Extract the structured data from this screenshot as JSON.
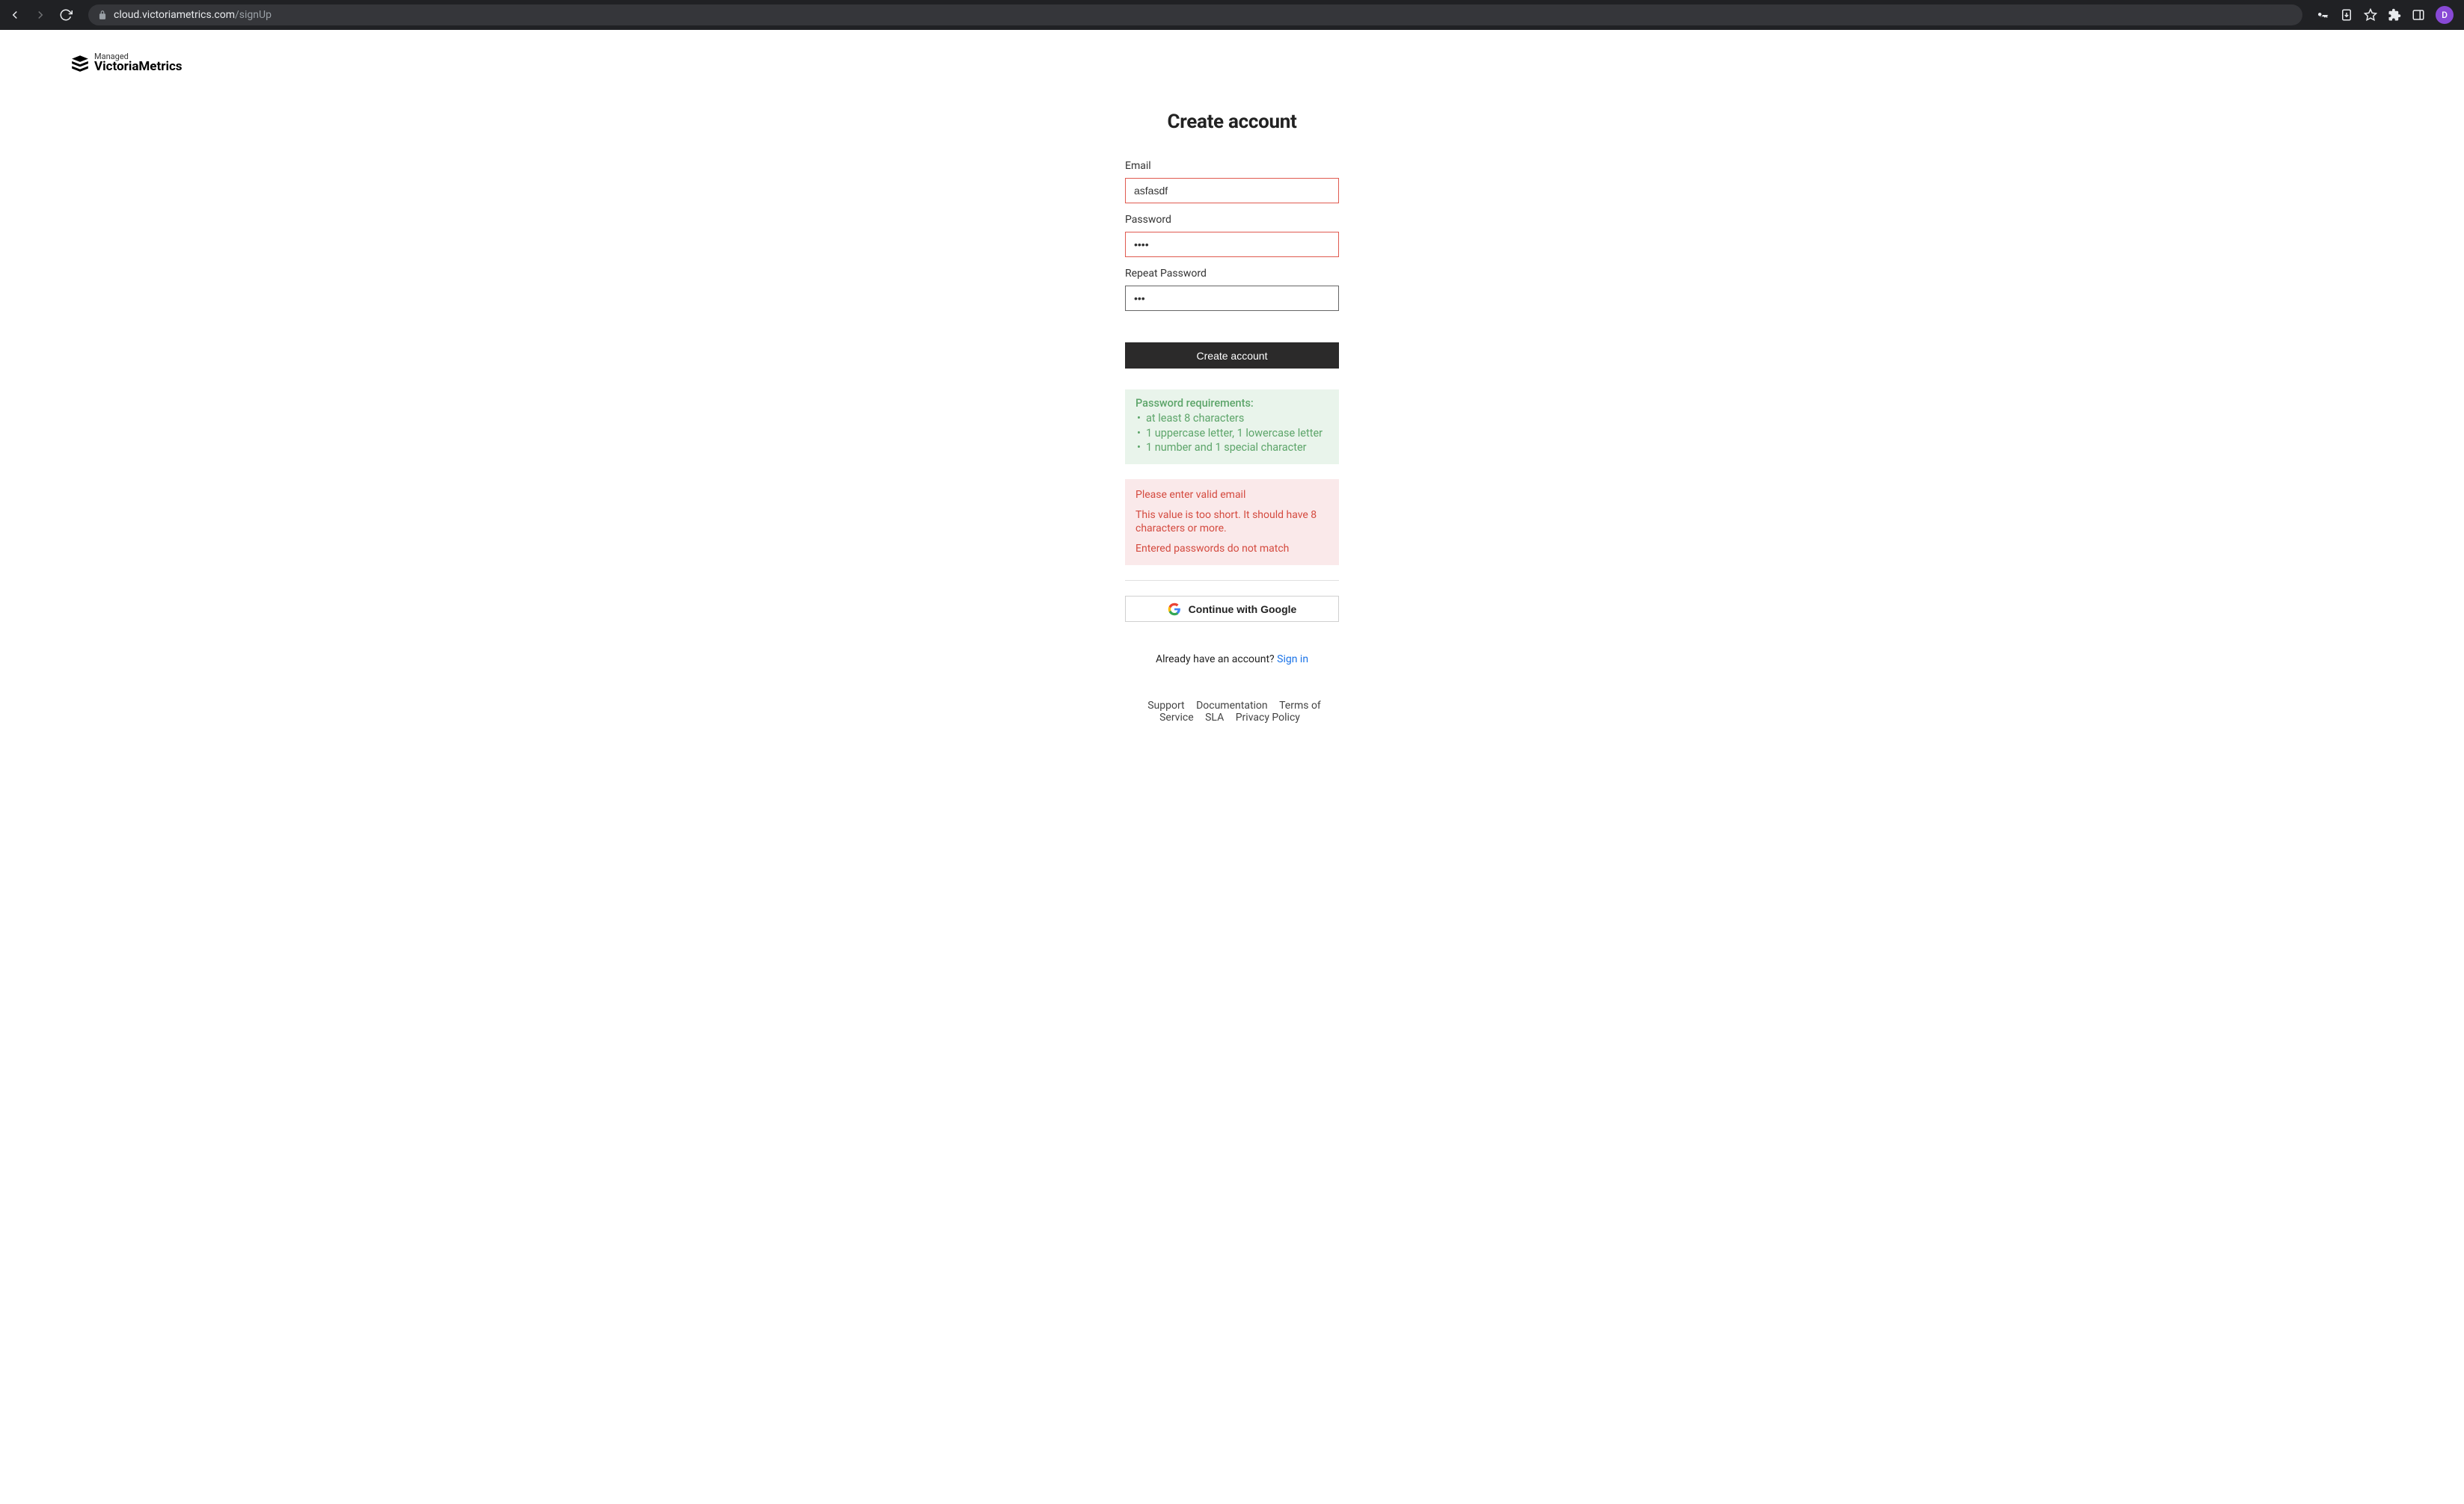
{
  "browser": {
    "url_domain": "cloud.victoriametrics.com",
    "url_path": "/signUp",
    "avatar_letter": "D"
  },
  "logo": {
    "managed": "Managed",
    "name": "VictoriaMetrics"
  },
  "page_title": "Create account",
  "fields": {
    "email": {
      "label": "Email",
      "value": "asfasdf"
    },
    "password": {
      "label": "Password",
      "value": "••••"
    },
    "repeat_password": {
      "label": "Repeat Password",
      "value": "•••"
    }
  },
  "submit_label": "Create account",
  "requirements": {
    "title": "Password requirements:",
    "items": [
      "at least 8 characters",
      "1 uppercase letter, 1 lowercase letter",
      "1 number and 1 special character"
    ]
  },
  "errors": [
    "Please enter valid email",
    "This value is too short. It should have 8 characters or more.",
    "Entered passwords do not match"
  ],
  "oauth": {
    "google_label": "Continue with Google"
  },
  "alt": {
    "prompt": "Already have an account? ",
    "link": "Sign in"
  },
  "footer": {
    "links": [
      "Support",
      "Documentation",
      "Terms of Service",
      "SLA",
      "Privacy Policy"
    ]
  }
}
